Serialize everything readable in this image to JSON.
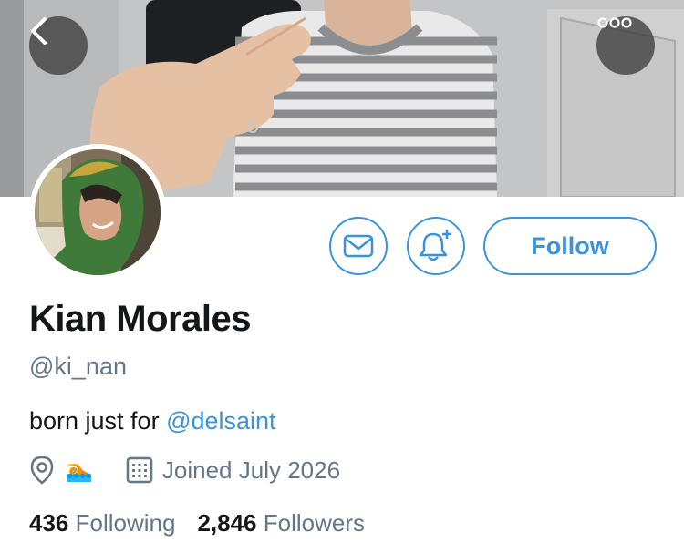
{
  "profile": {
    "name": "Kian Morales",
    "handle": "@ki_nan",
    "bio_prefix": "born just for ",
    "bio_mention": "@delsaint",
    "location_emoji": "🏊",
    "joined": "Joined July 2026"
  },
  "actions": {
    "follow_label": "Follow"
  },
  "stats": {
    "following_count": "436",
    "following_label": "Following",
    "followers_count": "2,846",
    "followers_label": "Followers"
  },
  "icons": {
    "back": "chevron-left-icon",
    "more": "more-icon",
    "message": "envelope-icon",
    "notifications": "bell-plus-icon",
    "location": "location-pin-icon",
    "calendar": "calendar-icon"
  },
  "colors": {
    "accent": "#3b94d9",
    "secondary_text": "#657786",
    "primary_text": "#14171a"
  }
}
